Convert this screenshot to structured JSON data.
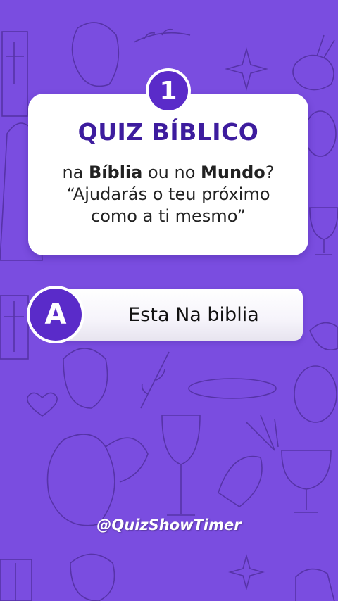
{
  "quiz": {
    "number": "1",
    "title": "QUIZ BÍBLICO",
    "question": {
      "line1_a": "na ",
      "line1_b": "Bíblia",
      "line1_c": " ou no ",
      "line1_d": "Mundo",
      "line1_e": "?",
      "line2": "“Ajudarás o teu próximo",
      "line3": "como a ti mesmo”"
    }
  },
  "answer": {
    "letter": "A",
    "text": "Esta Na biblia"
  },
  "watermark": "@QuizShowTimer",
  "colors": {
    "background": "#7a4de0",
    "accent": "#5a2bc9",
    "title": "#3d1c9e"
  }
}
